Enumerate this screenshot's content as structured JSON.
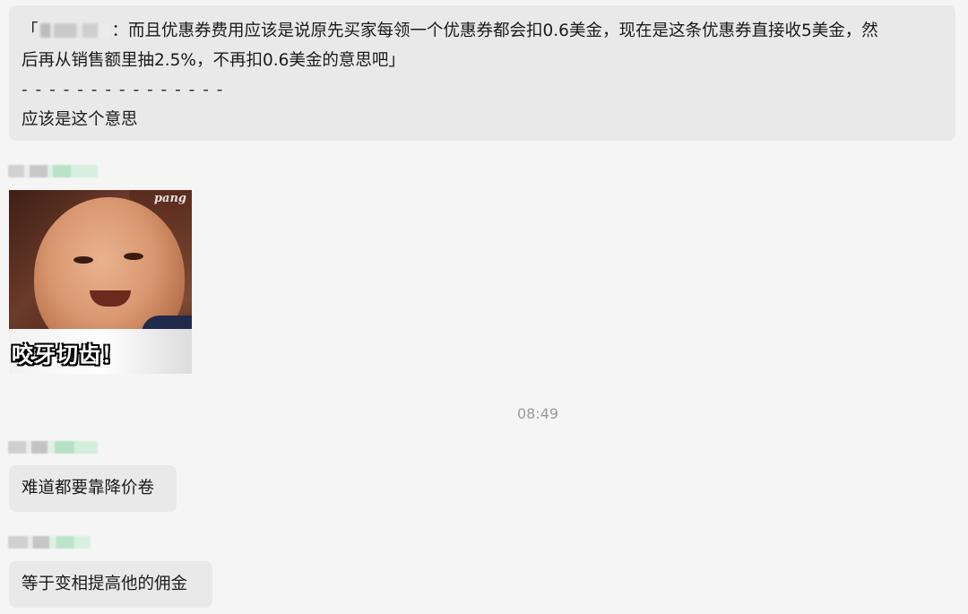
{
  "quote": {
    "open_bracket": "「",
    "line1_after_name": "：而且优惠券费用应该是说原先买家每领一个优惠券都会扣0.6美金，现在是这条优惠券直接收5美金，然",
    "line2": "后再从销售额里抽2.5%，不再扣0.6美金的意思吧」",
    "divider": "- - - - - - - - - - - - - - -",
    "reply": "应该是这个意思"
  },
  "sticker": {
    "watermark": "pang",
    "caption": "咬牙切齿！"
  },
  "timestamp": "08:49",
  "messages": [
    {
      "text": "难道都要靠降价卷"
    },
    {
      "text": "等于变相提高他的佣金"
    }
  ]
}
